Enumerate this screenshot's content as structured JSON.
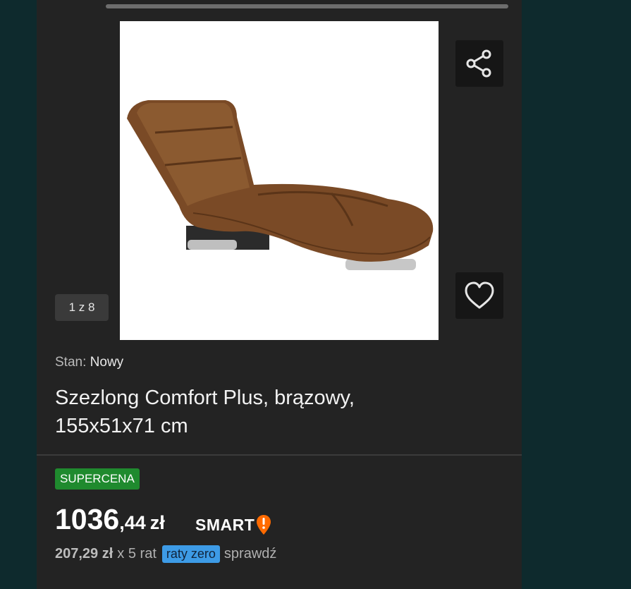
{
  "gallery": {
    "counter_text": "1 z 8",
    "image_icon": "chaise-lounge-image"
  },
  "actions": {
    "share_icon": "share-icon",
    "favorite_icon": "heart-icon"
  },
  "product": {
    "condition_label": "Stan:",
    "condition_value": "Nowy",
    "title": "Szezlong Comfort Plus, brązowy, 155x51x71 cm"
  },
  "pricing": {
    "badge": "SUPERCENA",
    "price_main": "1036",
    "price_cents": ",44",
    "currency": "zł",
    "smart_label": "SMART",
    "installment_amount": "207,29 zł",
    "installment_terms": "x 5 rat",
    "installment_badge": "raty zero",
    "installment_link": "sprawdź"
  },
  "colors": {
    "badge_green": "#1f8a2e",
    "raty_blue": "#3d9be6",
    "smart_orange": "#ff6a00",
    "panel_bg": "#232323"
  }
}
